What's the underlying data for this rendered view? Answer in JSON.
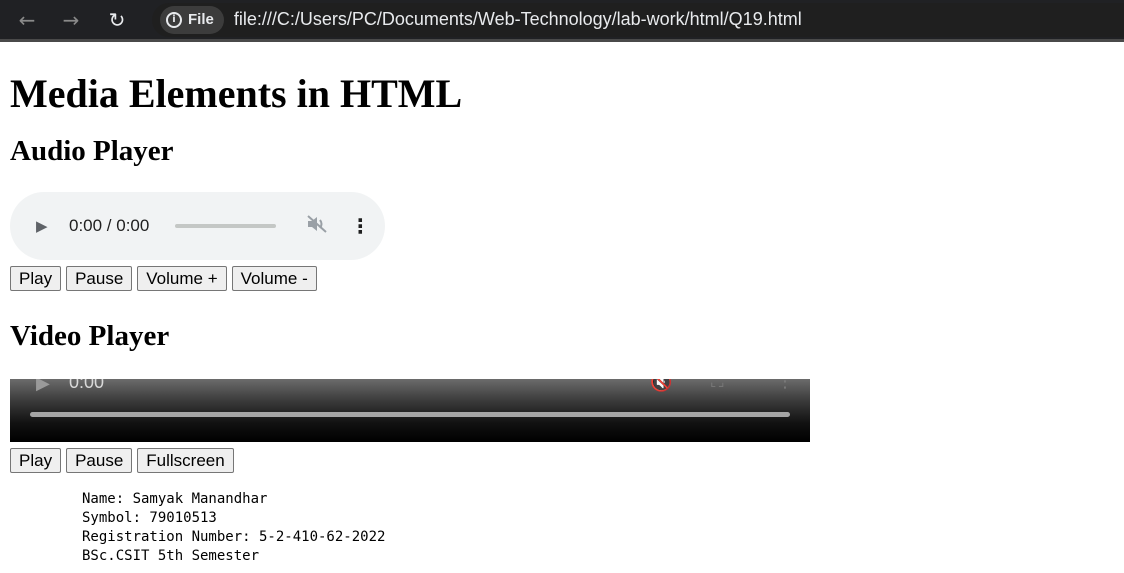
{
  "browser": {
    "back_icon": "←",
    "forward_icon": "→",
    "reload_icon": "↻",
    "site_chip": "File",
    "url": "file:///C:/Users/PC/Documents/Web-Technology/lab-work/html/Q19.html"
  },
  "page": {
    "title": "Media Elements in HTML",
    "audio_heading": "Audio Player",
    "video_heading": "Video Player"
  },
  "audio": {
    "time": "0:00 / 0:00",
    "buttons": [
      "Play",
      "Pause",
      "Volume +",
      "Volume -"
    ]
  },
  "video": {
    "time": "0:00",
    "buttons": [
      "Play",
      "Pause",
      "Fullscreen"
    ]
  },
  "info": {
    "lines": [
      "Name: Samyak Manandhar",
      "Symbol: 79010513",
      "Registration Number: 5-2-410-62-2022",
      "BSc.CSIT 5th Semester"
    ]
  }
}
